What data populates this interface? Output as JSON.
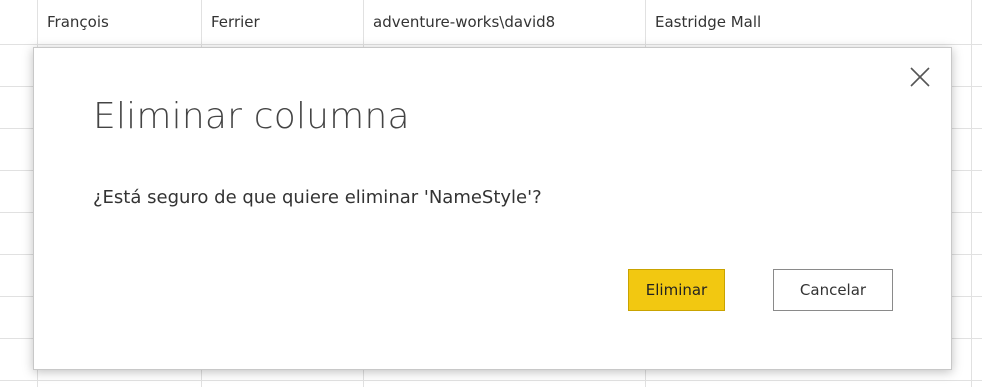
{
  "table": {
    "row": [
      "François",
      "Ferrier",
      "adventure-works\\david8",
      "Eastridge Mall"
    ]
  },
  "dialog": {
    "title": "Eliminar columna",
    "message": "¿Está seguro de que quiere eliminar 'NameStyle'?",
    "confirm_label": "Eliminar",
    "cancel_label": "Cancelar",
    "close_icon": "close-icon",
    "accent_color": "#f2c811"
  }
}
